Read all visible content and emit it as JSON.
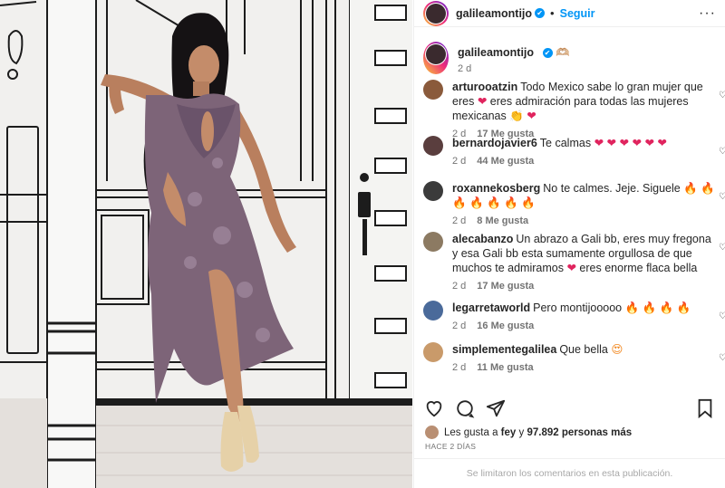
{
  "post": {
    "username": "galileamontijo",
    "verified_mark": "✔",
    "follow_label": "Seguir",
    "more_label": "···",
    "caption_emojis": "🫶🏼",
    "caption_time": "2 d"
  },
  "comments": [
    {
      "user": "arturooatzin",
      "text": "Todo Mexico sabe lo gran mujer que eres",
      "emojis": [
        {
          "t": "❤",
          "c": "red"
        }
      ],
      "text2": "eres admiración para todas las mujeres mexicanas",
      "emojis2": [
        {
          "t": "👏",
          "c": "orange"
        },
        {
          "t": "❤",
          "c": "red"
        }
      ],
      "time": "2 d",
      "likes": "17 Me gusta",
      "avatar": "#8a5a3b"
    },
    {
      "user": "bernardojavier6",
      "text": "Te calmas",
      "emojis": [
        {
          "t": "❤",
          "c": "red"
        },
        {
          "t": "❤",
          "c": "red"
        },
        {
          "t": "❤",
          "c": "red"
        },
        {
          "t": "❤",
          "c": "red"
        },
        {
          "t": "❤",
          "c": "red"
        },
        {
          "t": "❤",
          "c": "red"
        }
      ],
      "time": "2 d",
      "likes": "44 Me gusta",
      "avatar": "#5a3e3e"
    },
    {
      "user": "roxannekosberg",
      "text": "No te calmes. Jeje. Siguele",
      "emojis": [
        {
          "t": "🔥",
          "c": "orange"
        },
        {
          "t": "🔥",
          "c": "orange"
        },
        {
          "t": "🔥",
          "c": "orange"
        },
        {
          "t": "🔥",
          "c": "orange"
        },
        {
          "t": "🔥",
          "c": "orange"
        },
        {
          "t": "🔥",
          "c": "orange"
        },
        {
          "t": "🔥",
          "c": "orange"
        }
      ],
      "time": "2 d",
      "likes": "8 Me gusta",
      "avatar": "#3b3b3b"
    },
    {
      "user": "alecabanzo",
      "text": "Un abrazo a Gali bb, eres muy fregona y esa Gali bb esta sumamente orgullosa de que muchos te admiramos",
      "emojis": [
        {
          "t": "❤",
          "c": "red"
        }
      ],
      "text2": "eres enorme flaca bella",
      "time": "2 d",
      "likes": "17 Me gusta",
      "avatar": "#8c7a62"
    },
    {
      "user": "legarretaworld",
      "text": "Pero montijooooo",
      "emojis": [
        {
          "t": "🔥",
          "c": "orange"
        },
        {
          "t": "🔥",
          "c": "orange"
        },
        {
          "t": "🔥",
          "c": "orange"
        },
        {
          "t": "🔥",
          "c": "orange"
        }
      ],
      "time": "2 d",
      "likes": "16 Me gusta",
      "avatar": "#4a6a9a"
    },
    {
      "user": "simplementegalilea",
      "text": "Que bella",
      "emojis": [
        {
          "t": "😍",
          "c": "orange"
        }
      ],
      "time": "2 d",
      "likes": "11 Me gusta",
      "avatar": "#c99a6a"
    }
  ],
  "likes_line": {
    "prefix": "Les gusta a",
    "user": "fey",
    "middle": "y",
    "count": "97.892 personas más"
  },
  "posted_when": "HACE 2 DÍAS",
  "comments_closed": "Se limitaron los comentarios en esta publicación.",
  "icons": [
    "heart-icon",
    "comment-icon",
    "share-icon",
    "bookmark-icon"
  ]
}
